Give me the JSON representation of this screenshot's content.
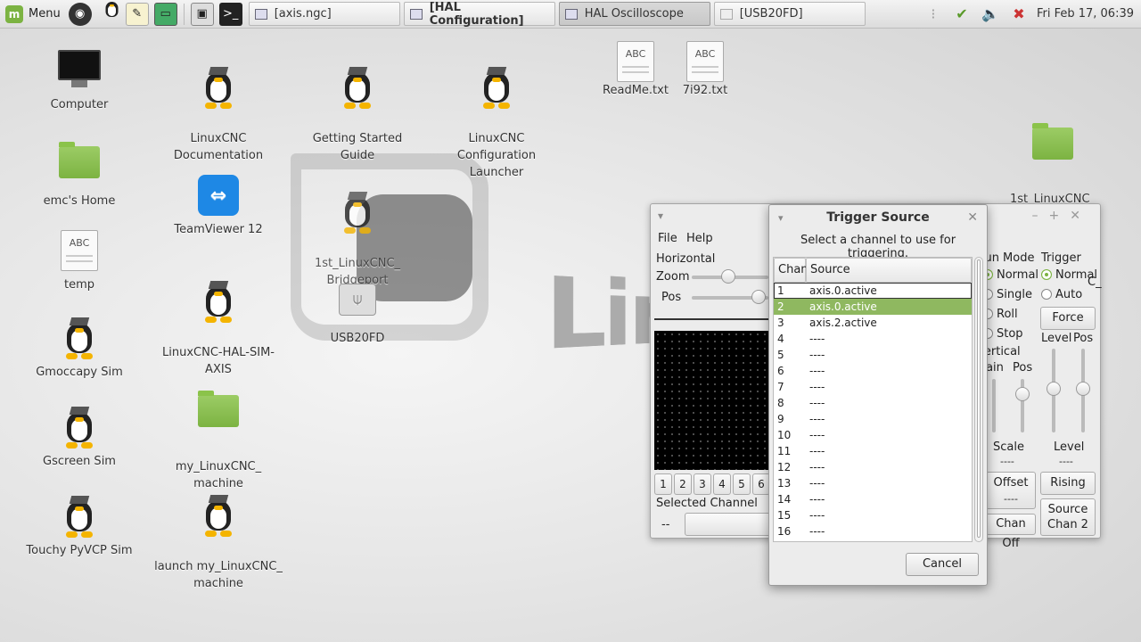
{
  "panel": {
    "menu_label": "Menu",
    "tasks": [
      "[axis.ngc]",
      "[HAL Configuration]",
      "HAL Oscilloscope",
      "[USB20FD]"
    ],
    "clock": "Fri Feb 17, 06:39"
  },
  "desktop": {
    "icons": {
      "computer": "Computer",
      "linuxcnc_docs": "LinuxCNC\nDocumentation",
      "getting_started": "Getting Started\nGuide",
      "config_launcher": "LinuxCNC\nConfiguration\nLauncher",
      "readme": "ReadMe.txt",
      "file_7i92": "7i92.txt",
      "bridgeport_top": "1st_LinuxCNC_\nBridgeport",
      "home": "emc's Home",
      "teamviewer": "TeamViewer 12",
      "bridgeport_mid": "1st_LinuxCNC_\nBridgeport",
      "temp": "temp",
      "hal_sim_axis": "LinuxCNC-HAL-SIM-\nAXIS",
      "usb": "USB20FD",
      "gmoccapy": "Gmoccapy Sim",
      "my_machine": "my_LinuxCNC_\nmachine",
      "gscreen": "Gscreen Sim",
      "launch_machine": "launch my_LinuxCNC_\nmachine",
      "touchy": "Touchy PyVCP Sim"
    },
    "doc_icon_text": "ABC"
  },
  "scope": {
    "menu_file": "File",
    "menu_help": "Help",
    "horizontal": "Horizontal",
    "zoom": "Zoom",
    "pos": "Pos",
    "channels": [
      "1",
      "2",
      "3",
      "4",
      "5",
      "6"
    ],
    "selected_channel_label": "Selected Channel",
    "selected_channel_value": "--",
    "run_mode": "Run Mode",
    "run_normal": "Normal",
    "run_single": "Single",
    "run_roll": "Roll",
    "run_stop": "Stop",
    "trigger": "Trigger",
    "trig_normal": "Normal",
    "trig_auto": "Auto",
    "force": "Force",
    "level": "Level",
    "tpos": "Pos",
    "vertical": "Vertical",
    "gain": "Gain",
    "vpos": "Pos",
    "scale": "Scale",
    "scale_val": "----",
    "level2": "Level",
    "level2_val": "----",
    "offset": "Offset",
    "offset_val": "----",
    "rising": "Rising",
    "chan_off": "Chan Off",
    "source": "Source",
    "source_chan": "Chan  2",
    "right_edge_text": "C_"
  },
  "dialog": {
    "title": "Trigger Source",
    "instruction": "Select a channel to use for triggering.",
    "col_chan": "Chan",
    "col_source": "Source",
    "rows": [
      {
        "chan": "1",
        "source": "axis.0.active"
      },
      {
        "chan": "2",
        "source": "axis.0.active"
      },
      {
        "chan": "3",
        "source": "axis.2.active"
      },
      {
        "chan": "4",
        "source": "----"
      },
      {
        "chan": "5",
        "source": "----"
      },
      {
        "chan": "6",
        "source": "----"
      },
      {
        "chan": "7",
        "source": "----"
      },
      {
        "chan": "8",
        "source": "----"
      },
      {
        "chan": "9",
        "source": "----"
      },
      {
        "chan": "10",
        "source": "----"
      },
      {
        "chan": "11",
        "source": "----"
      },
      {
        "chan": "12",
        "source": "----"
      },
      {
        "chan": "13",
        "source": "----"
      },
      {
        "chan": "14",
        "source": "----"
      },
      {
        "chan": "15",
        "source": "----"
      },
      {
        "chan": "16",
        "source": "----"
      }
    ],
    "selected_row": 2,
    "cancel": "Cancel"
  },
  "colors": {
    "accent": "#8fb860",
    "mint_green": "#7cb342"
  }
}
